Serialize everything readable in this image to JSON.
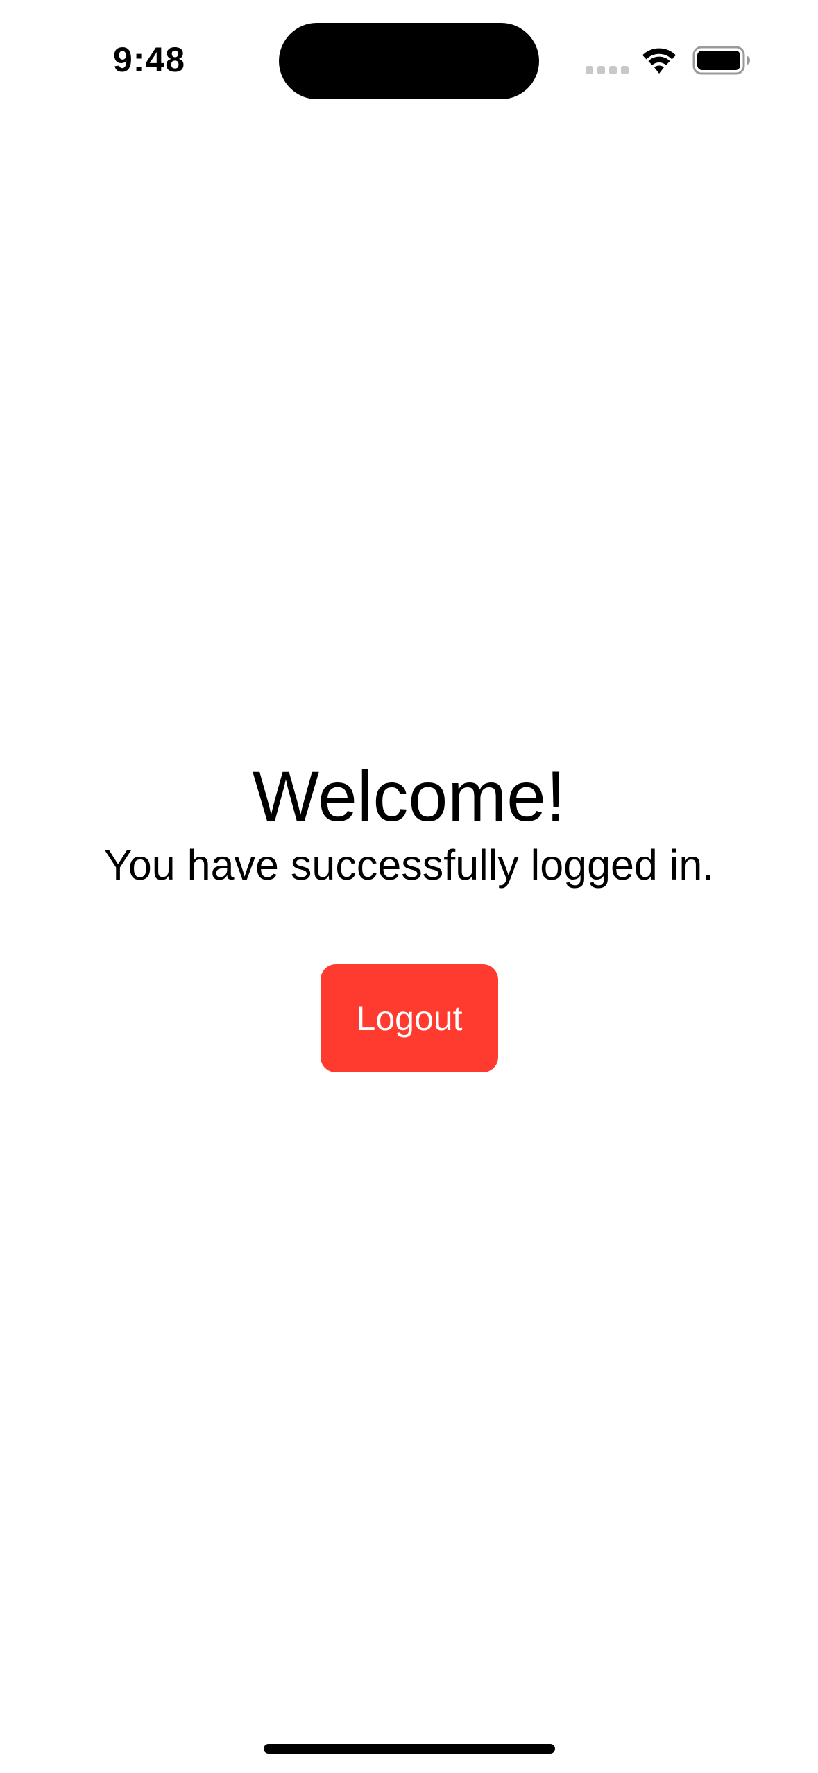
{
  "status_bar": {
    "time": "9:48",
    "signal_icon": "cellular-signal-icon",
    "wifi_icon": "wifi-icon",
    "battery_icon": "battery-icon"
  },
  "main": {
    "title": "Welcome!",
    "subtitle": "You have successfully logged in.",
    "logout_label": "Logout"
  },
  "colors": {
    "logout_button_bg": "#ff3b30",
    "logout_button_text": "#ffffff",
    "background": "#ffffff",
    "text": "#000000"
  }
}
